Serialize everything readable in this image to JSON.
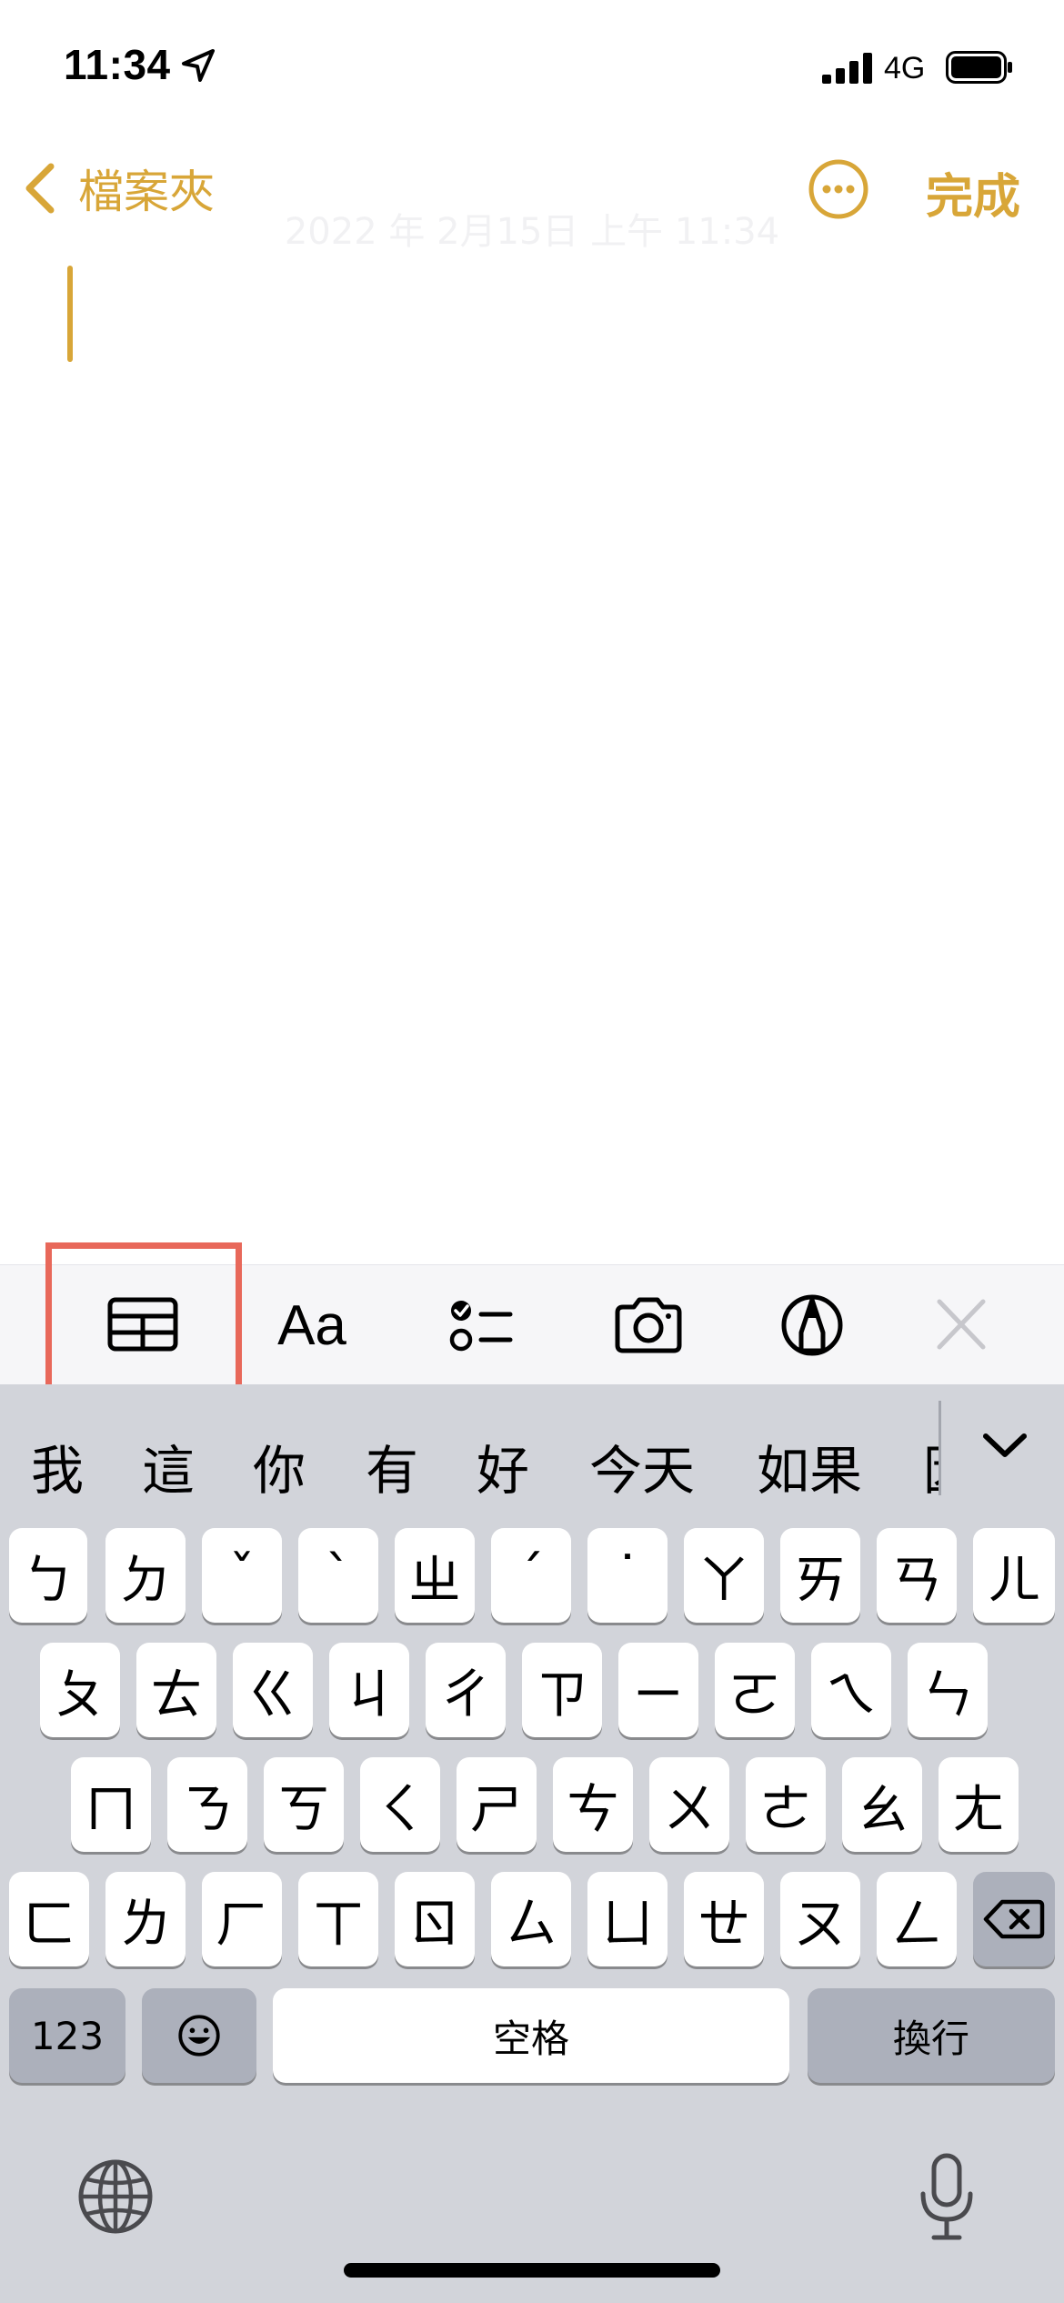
{
  "status_bar": {
    "time": "11:34",
    "network": "4G"
  },
  "nav": {
    "back_label": "檔案夾",
    "done_label": "完成"
  },
  "note": {
    "date": "2022 年 2月15日 上午 11:34",
    "body": ""
  },
  "colors": {
    "accent": "#D8A638",
    "highlight": "#E8685A",
    "keyboard_bg": "#D2D4DA",
    "toolbar_bg": "#F6F6F8"
  },
  "toolbar": {
    "items": [
      {
        "name": "table",
        "icon": "table-icon"
      },
      {
        "name": "format",
        "label": "Aa"
      },
      {
        "name": "checklist",
        "icon": "checklist-icon"
      },
      {
        "name": "camera",
        "icon": "camera-icon"
      },
      {
        "name": "markup",
        "icon": "markup-pen-icon"
      },
      {
        "name": "close",
        "icon": "close-icon"
      }
    ]
  },
  "candidates": [
    "我",
    "這",
    "你",
    "有",
    "好",
    "今天",
    "如果",
    "因"
  ],
  "keyboard": {
    "rows": [
      [
        "ㄅ",
        "ㄉ",
        "ˇ",
        "ˋ",
        "ㄓ",
        "ˊ",
        "˙",
        "ㄚ",
        "ㄞ",
        "ㄢ",
        "ㄦ"
      ],
      [
        "ㄆ",
        "ㄊ",
        "ㄍ",
        "ㄐ",
        "ㄔ",
        "ㄗ",
        "ㄧ",
        "ㄛ",
        "ㄟ",
        "ㄣ"
      ],
      [
        "ㄇ",
        "ㄋ",
        "ㄎ",
        "ㄑ",
        "ㄕ",
        "ㄘ",
        "ㄨ",
        "ㄜ",
        "ㄠ",
        "ㄤ"
      ],
      [
        "ㄈ",
        "ㄌ",
        "ㄏ",
        "ㄒ",
        "ㄖ",
        "ㄙ",
        "ㄩ",
        "ㄝ",
        "ㄡ",
        "ㄥ"
      ]
    ],
    "numbers_label": "123",
    "space_label": "空格",
    "return_label": "換行"
  }
}
